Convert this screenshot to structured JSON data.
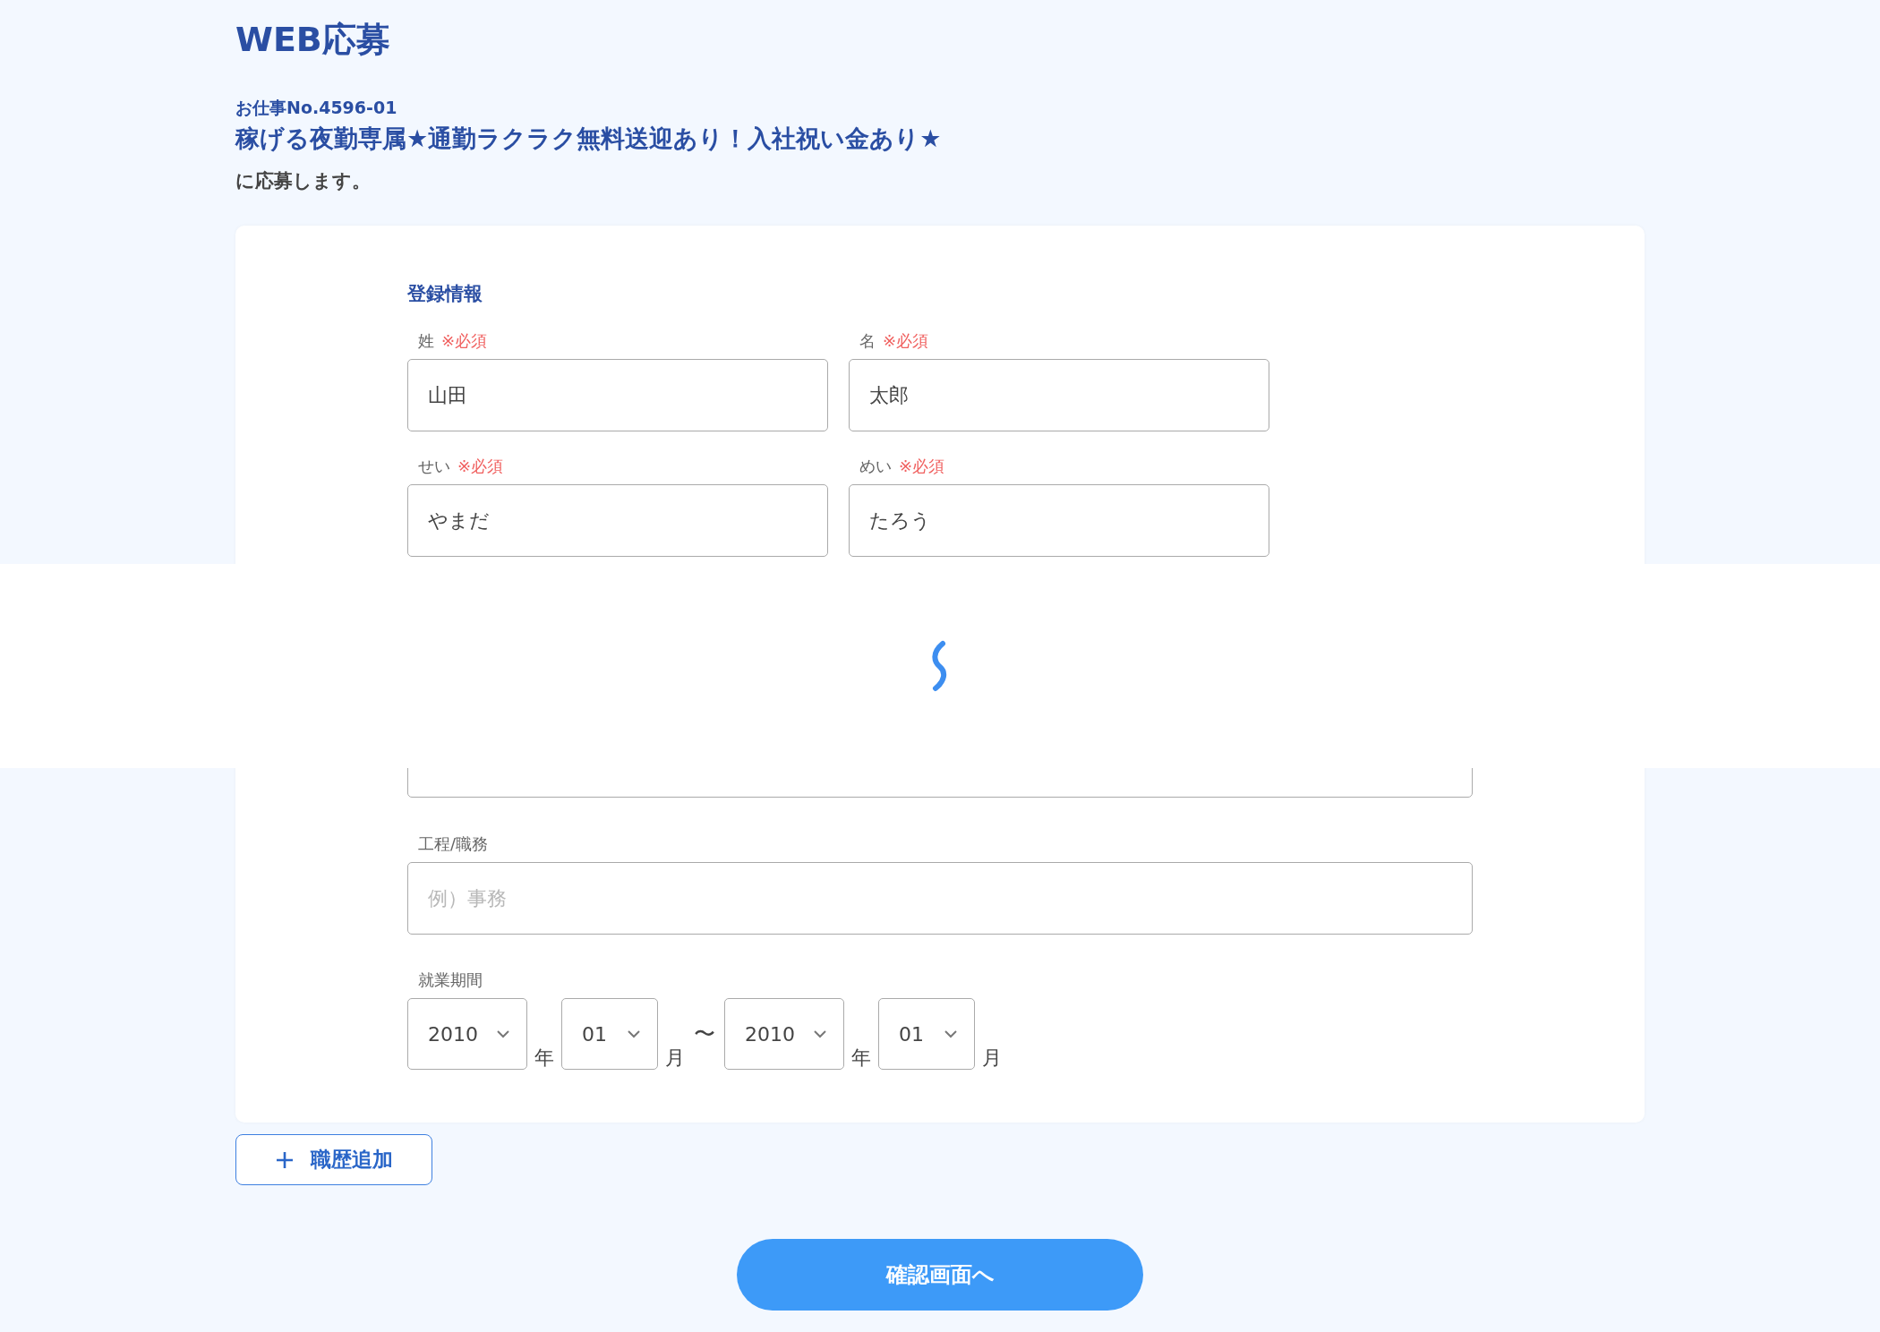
{
  "page_title": "WEB応募",
  "job": {
    "number": "お仕事No.4596-01",
    "title": "稼げる夜勤専属★通勤ラクラク無料送迎あり！入社祝い金あり★",
    "suffix": "に応募します。"
  },
  "form": {
    "section_title": "登録情報",
    "name_fields": [
      {
        "label": "姓",
        "required": "※必須",
        "value": "山田"
      },
      {
        "label": "名",
        "required": "※必須",
        "value": "太郎"
      },
      {
        "label": "せい",
        "required": "※必須",
        "value": "やまだ"
      },
      {
        "label": "めい",
        "required": "※必須",
        "value": "たろう"
      }
    ],
    "job_field": {
      "label": "工程/職務",
      "placeholder": "例）事務"
    },
    "period": {
      "label": "就業期間",
      "separator": "〜",
      "from": {
        "year": "2010",
        "year_unit": "年",
        "month": "01",
        "month_unit": "月"
      },
      "to": {
        "year": "2010",
        "year_unit": "年",
        "month": "01",
        "month_unit": "月"
      }
    }
  },
  "add_button": {
    "label": "職歴追加"
  },
  "confirm_button": {
    "label": "確認画面へ"
  },
  "loading": true
}
